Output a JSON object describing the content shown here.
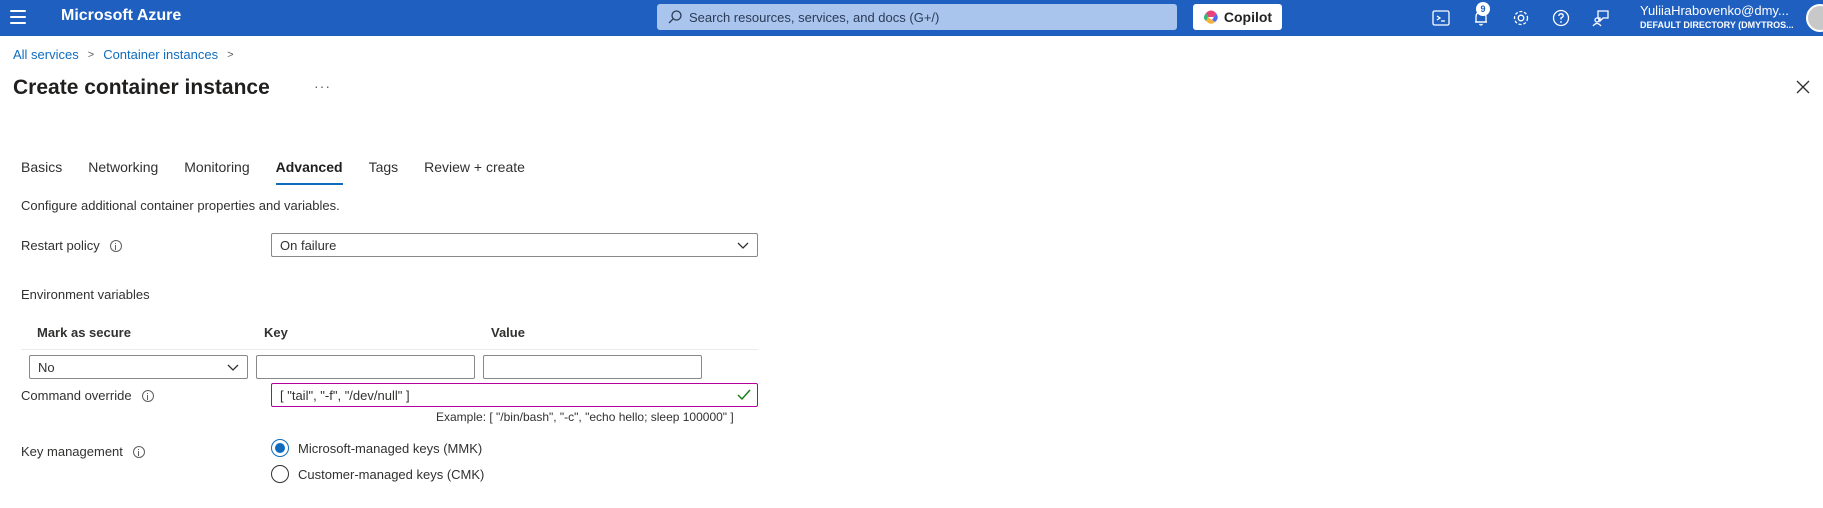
{
  "topbar": {
    "brand": "Microsoft Azure",
    "search_placeholder": "Search resources, services, and docs (G+/)",
    "copilot_label": "Copilot",
    "notification_count": "9",
    "user_name": "YuliiaHrabovenko@dmy...",
    "user_directory": "DEFAULT DIRECTORY (DMYTROS..."
  },
  "breadcrumb": {
    "items": [
      "All services",
      "Container instances"
    ],
    "separator": ">"
  },
  "page": {
    "title": "Create container instance",
    "more_label": "···"
  },
  "tabs": [
    {
      "label": "Basics",
      "active": false
    },
    {
      "label": "Networking",
      "active": false
    },
    {
      "label": "Monitoring",
      "active": false
    },
    {
      "label": "Advanced",
      "active": true
    },
    {
      "label": "Tags",
      "active": false
    },
    {
      "label": "Review + create",
      "active": false
    }
  ],
  "form": {
    "description": "Configure additional container properties and variables.",
    "restart_policy": {
      "label": "Restart policy",
      "value": "On failure"
    },
    "env": {
      "section_label": "Environment variables",
      "col_secure": "Mark as secure",
      "col_key": "Key",
      "col_value": "Value",
      "row_secure_value": "No",
      "row_key": "",
      "row_value": ""
    },
    "command_override": {
      "label": "Command override",
      "value": "[ \"tail\", \"-f\", \"/dev/null\" ]",
      "example": "Example: [ \"/bin/bash\", \"-c\", \"echo hello; sleep 100000\" ]"
    },
    "key_management": {
      "label": "Key management",
      "options": [
        {
          "label": "Microsoft-managed keys (MMK)",
          "selected": true
        },
        {
          "label": "Customer-managed keys (CMK)",
          "selected": false
        }
      ]
    }
  },
  "colors": {
    "topbar": "#1f5fbf",
    "accent": "#0f6cbd",
    "valid_border": "#b4009e",
    "check": "#107c10"
  }
}
